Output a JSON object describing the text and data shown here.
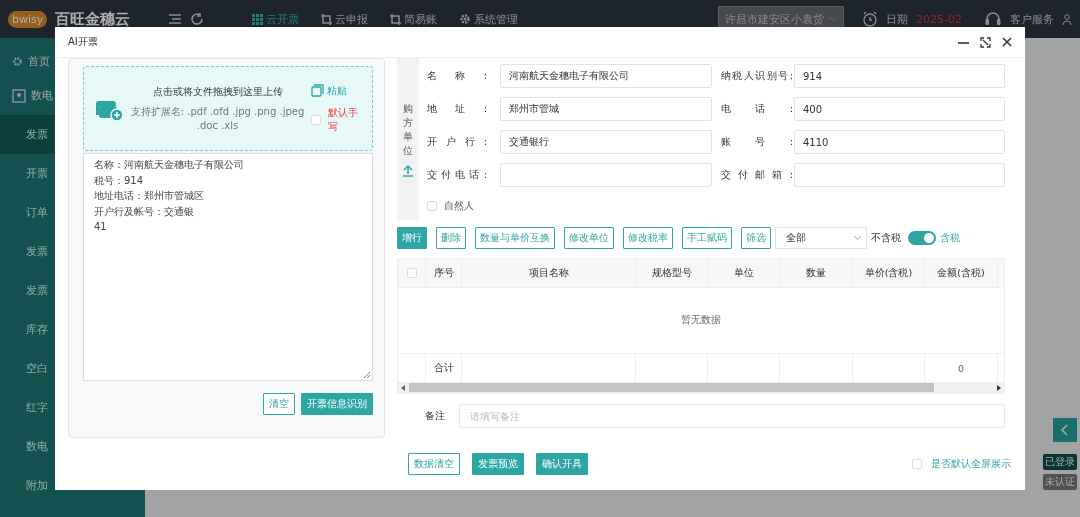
{
  "app": {
    "logo": "bwisy",
    "title": "百旺金穗云",
    "nav": [
      {
        "label": "云开票",
        "selected": true,
        "kind": "grid"
      },
      {
        "label": "云申报",
        "selected": false,
        "kind": "crop"
      },
      {
        "label": "简易账",
        "selected": false,
        "kind": "crop"
      },
      {
        "label": "系统管理",
        "selected": false,
        "kind": "gear"
      }
    ],
    "company_select": "许昌市建安区小袁货",
    "date_label": "日期",
    "date_value": "2025-02",
    "service": "客户服务"
  },
  "sidebar": [
    {
      "label": "首页",
      "selected": false,
      "kind": "home"
    },
    {
      "label": "数电",
      "selected": false,
      "kind": "group"
    },
    {
      "label": "发票",
      "selected": true,
      "kind": "sub"
    },
    {
      "label": "开票",
      "selected": false,
      "kind": "sub"
    },
    {
      "label": "订单",
      "selected": false,
      "kind": "sub"
    },
    {
      "label": "发票",
      "selected": false,
      "kind": "sub"
    },
    {
      "label": "发票",
      "selected": false,
      "kind": "sub"
    },
    {
      "label": "库存",
      "selected": false,
      "kind": "sub"
    },
    {
      "label": "空白",
      "selected": false,
      "kind": "sub"
    },
    {
      "label": "红字",
      "selected": false,
      "kind": "sub"
    },
    {
      "label": "数电",
      "selected": false,
      "kind": "sub"
    },
    {
      "label": "附加",
      "selected": false,
      "kind": "sub"
    }
  ],
  "side_badges": [
    {
      "label": "已登录",
      "kind": "ok"
    },
    {
      "label": "未认证",
      "kind": "muted"
    }
  ],
  "dialog": {
    "title": "AI开票",
    "upload": {
      "title": "点击或将文件拖拽到这里上传",
      "hint": "支持扩展名: .pdf .ofd .jpg .png .jpeg .doc .xls",
      "paste": "粘贴",
      "default_handwrite": {
        "label": "默认手写",
        "checked": false
      }
    },
    "recognized_text": [
      "名称：河南航天金穗电子有限公司",
      "税号：914",
      "地址电话：郑州市管城区",
      "开户行及帐号：交通银",
      "41"
    ],
    "clear": "清空",
    "recognize": "开票信息识别",
    "buyer_label": "购方单位",
    "fields": [
      {
        "label": "名称:",
        "value": "河南航天金穗电子有限公司"
      },
      {
        "label": "纳税人识别号:",
        "value": "914"
      },
      {
        "label": "地址:",
        "value": "郑州市管城"
      },
      {
        "label": "电话:",
        "value": "400"
      },
      {
        "label": "开户行:",
        "value": "交通银行"
      },
      {
        "label": "账号:",
        "value": "4110"
      },
      {
        "label": "交付电话:"
      },
      {
        "label": "交付邮箱:"
      }
    ],
    "natural_person": {
      "label": "自然人",
      "checked": false
    },
    "toolbar": [
      {
        "label": "增行",
        "kind": "primary"
      },
      {
        "label": "删除",
        "kind": "outline"
      },
      {
        "label": "数量与单价互换",
        "kind": "outline"
      },
      {
        "label": "修改单位",
        "kind": "outline"
      },
      {
        "label": "修改税率",
        "kind": "outline"
      },
      {
        "label": "手工赋码",
        "kind": "outline"
      },
      {
        "label": "筛选",
        "kind": "outline"
      }
    ],
    "filter": "全部",
    "tax_toggle": {
      "off_label": "不含税",
      "on_label": "含税",
      "on": true
    },
    "table": {
      "select_all": {
        "checked": false
      },
      "columns": [
        "序号",
        "项目名称",
        "规格型号",
        "单位",
        "数量",
        "单价(含税)",
        "金额(含税)"
      ],
      "empty": "暂无数据",
      "total_label": "合计",
      "total_amount": "0"
    },
    "remark": {
      "label": "备注",
      "placeholder": "请填写备注"
    },
    "actions": [
      {
        "label": "数据清空",
        "kind": "outline"
      },
      {
        "label": "发票预览",
        "kind": "primary"
      },
      {
        "label": "确认开具",
        "kind": "primary"
      }
    ],
    "fullscreen_default": {
      "label": "是否默认全屏展示",
      "checked": false
    }
  }
}
